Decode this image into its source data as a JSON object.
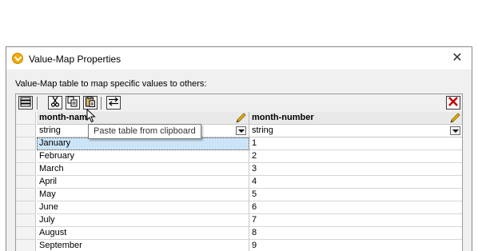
{
  "window": {
    "title": "Value-Map Properties",
    "close_glyph": "✕"
  },
  "description": "Value-Map table to map specific values to others:",
  "toolbar": {
    "buttons": [
      "table-layout-icon",
      "cut-icon",
      "copy-icon",
      "paste-icon",
      "swap-columns-icon",
      "delete-icon"
    ]
  },
  "columns": [
    {
      "header": "month-nam",
      "type": "string"
    },
    {
      "header": "month-number",
      "type": "string"
    }
  ],
  "rows": [
    [
      "January",
      "1"
    ],
    [
      "February",
      "2"
    ],
    [
      "March",
      "3"
    ],
    [
      "April",
      "4"
    ],
    [
      "May",
      "5"
    ],
    [
      "June",
      "6"
    ],
    [
      "July",
      "7"
    ],
    [
      "August",
      "8"
    ],
    [
      "September",
      "9"
    ]
  ],
  "tooltip": "Paste table from clipboard",
  "colors": {
    "selection": "#cce4f7",
    "delete_red": "#c00000",
    "app_icon": "#f2a900"
  }
}
